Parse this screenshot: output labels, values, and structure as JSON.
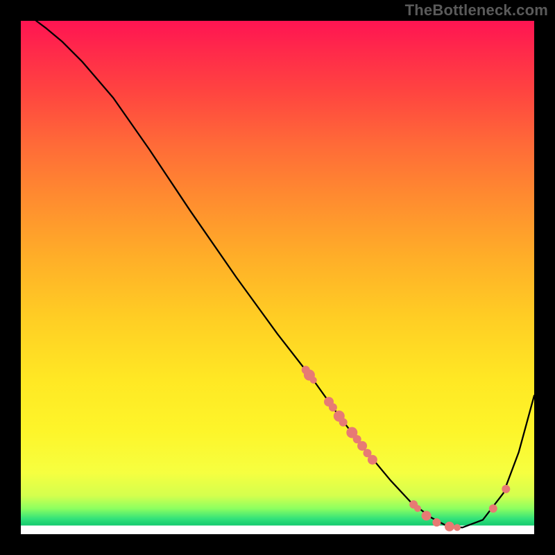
{
  "watermark": "TheBottleneck.com",
  "chart_data": {
    "type": "line",
    "title": "",
    "xlabel": "",
    "ylabel": "",
    "xlim": [
      0,
      100
    ],
    "ylim": [
      0,
      100
    ],
    "series": [
      {
        "name": "curve",
        "x": [
          3,
          5,
          8,
          12,
          18,
          25,
          33,
          42,
          50,
          57,
          62,
          67,
          72,
          76,
          80,
          83,
          86,
          90,
          94,
          97,
          100
        ],
        "y": [
          100,
          98.5,
          96,
          92,
          85,
          75,
          63,
          50,
          39,
          30,
          23,
          16.5,
          10.5,
          6.2,
          3.2,
          1.6,
          1.3,
          2.8,
          8,
          16,
          27
        ]
      }
    ],
    "markers": {
      "name": "dots",
      "color": "#e77a74",
      "points": [
        {
          "x": 55.5,
          "y": 32.0,
          "r": 6
        },
        {
          "x": 56.2,
          "y": 31.0,
          "r": 8
        },
        {
          "x": 57.0,
          "y": 30.0,
          "r": 5
        },
        {
          "x": 60.0,
          "y": 25.8,
          "r": 7
        },
        {
          "x": 60.8,
          "y": 24.7,
          "r": 6
        },
        {
          "x": 62.0,
          "y": 23.0,
          "r": 8
        },
        {
          "x": 62.8,
          "y": 21.8,
          "r": 6
        },
        {
          "x": 64.5,
          "y": 19.8,
          "r": 8
        },
        {
          "x": 65.5,
          "y": 18.5,
          "r": 6
        },
        {
          "x": 66.5,
          "y": 17.2,
          "r": 7
        },
        {
          "x": 67.5,
          "y": 15.8,
          "r": 6
        },
        {
          "x": 68.5,
          "y": 14.5,
          "r": 7
        },
        {
          "x": 76.5,
          "y": 5.8,
          "r": 6
        },
        {
          "x": 77.3,
          "y": 5.0,
          "r": 5
        },
        {
          "x": 79.0,
          "y": 3.6,
          "r": 7
        },
        {
          "x": 81.0,
          "y": 2.3,
          "r": 6
        },
        {
          "x": 83.5,
          "y": 1.5,
          "r": 7
        },
        {
          "x": 85.0,
          "y": 1.3,
          "r": 5
        },
        {
          "x": 92.0,
          "y": 5.0,
          "r": 6
        },
        {
          "x": 94.5,
          "y": 8.8,
          "r": 6
        }
      ]
    }
  }
}
